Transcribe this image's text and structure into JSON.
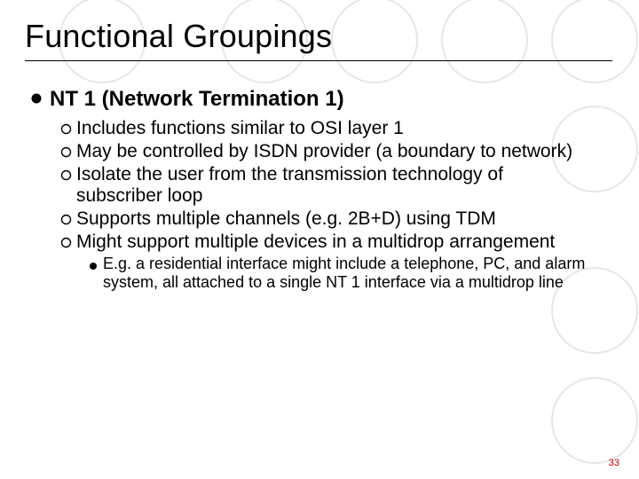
{
  "colors": {
    "circle_stroke": "#e6e6e6",
    "page_number_color": "#c00000"
  },
  "title": "Functional Groupings",
  "page_number": "33",
  "l1": {
    "text": "NT 1 (Network Termination 1)"
  },
  "l2": [
    {
      "text": "Includes functions similar to OSI layer 1"
    },
    {
      "text": "May be controlled by ISDN provider (a boundary to network)"
    },
    {
      "text": "Isolate the user from the transmission technology of subscriber loop"
    },
    {
      "text": "Supports multiple channels (e.g. 2B+D) using TDM"
    },
    {
      "text": "Might support multiple devices in a multidrop arrangement"
    }
  ],
  "l3": [
    {
      "text": "E.g. a residential interface might include a telephone, PC, and alarm system, all attached to a single NT 1 interface via a multidrop line"
    }
  ]
}
